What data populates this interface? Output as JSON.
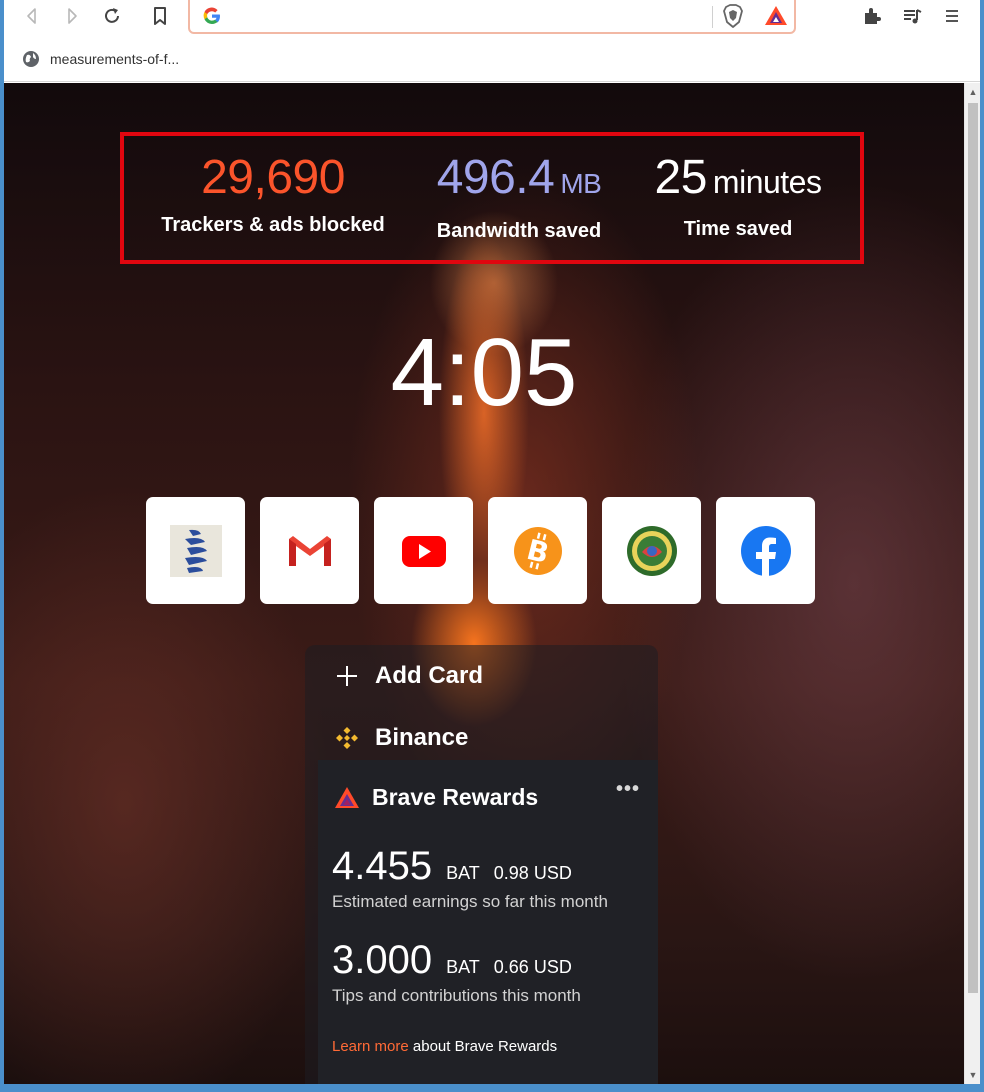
{
  "browser": {
    "bookmark_label": "measurements-of-f...",
    "omnibox_value": ""
  },
  "stats": {
    "trackers_value": "29,690",
    "trackers_label": "Trackers & ads blocked",
    "trackers_color": "#fb542b",
    "bandwidth_value": "496.4",
    "bandwidth_unit": "MB",
    "bandwidth_label": "Bandwidth saved",
    "bandwidth_color": "#a0a5eb",
    "time_value": "25",
    "time_unit": "minutes",
    "time_label": "Time saved",
    "highlight_color": "#e0060f"
  },
  "clock": "4:05",
  "top_sites": [
    {
      "name": "site-blue-logo",
      "icon": "striped-logo-icon"
    },
    {
      "name": "gmail",
      "icon": "gmail-icon"
    },
    {
      "name": "youtube",
      "icon": "youtube-icon"
    },
    {
      "name": "bitcoin",
      "icon": "bitcoin-icon"
    },
    {
      "name": "seal",
      "icon": "seal-icon"
    },
    {
      "name": "facebook",
      "icon": "facebook-icon"
    }
  ],
  "cards": {
    "add_card": "Add Card",
    "binance": "Binance",
    "rewards_title": "Brave Rewards",
    "more": "•••",
    "earnings_amount": "4.455",
    "earnings_unit": "BAT",
    "earnings_usd": "0.98 USD",
    "earnings_desc": "Estimated earnings so far this month",
    "tips_amount": "3.000",
    "tips_unit": "BAT",
    "tips_usd": "0.66 USD",
    "tips_desc": "Tips and contributions this month",
    "learn_link": "Learn more",
    "learn_rest": "about Brave Rewards"
  }
}
